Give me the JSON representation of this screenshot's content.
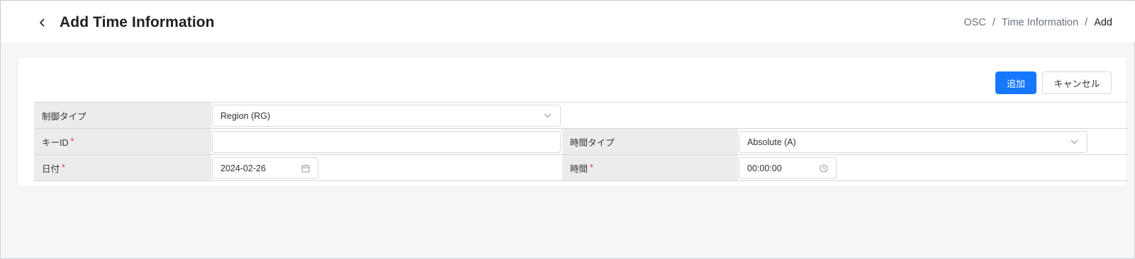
{
  "header": {
    "title": "Add Time Information",
    "back_icon": "chevron-left-icon",
    "breadcrumb": [
      "OSC",
      "Time Information",
      "Add"
    ],
    "separator": "/"
  },
  "actions": {
    "add_label": "追加",
    "cancel_label": "キャンセル",
    "primary_color": "#1677ff"
  },
  "form": {
    "control_type": {
      "label": "制御タイプ",
      "value": "Region (RG)",
      "icon": "chevron-down-icon"
    },
    "key_id": {
      "label": "キーID",
      "required": "*",
      "value": ""
    },
    "time_type": {
      "label": "時間タイプ",
      "value": "Absolute (A)",
      "icon": "chevron-down-icon"
    },
    "date": {
      "label": "日付",
      "required": "*",
      "value": "2024-02-26",
      "icon": "calendar-icon"
    },
    "time": {
      "label": "時間",
      "required": "*",
      "value": "00:00:00",
      "icon": "clock-icon"
    }
  }
}
